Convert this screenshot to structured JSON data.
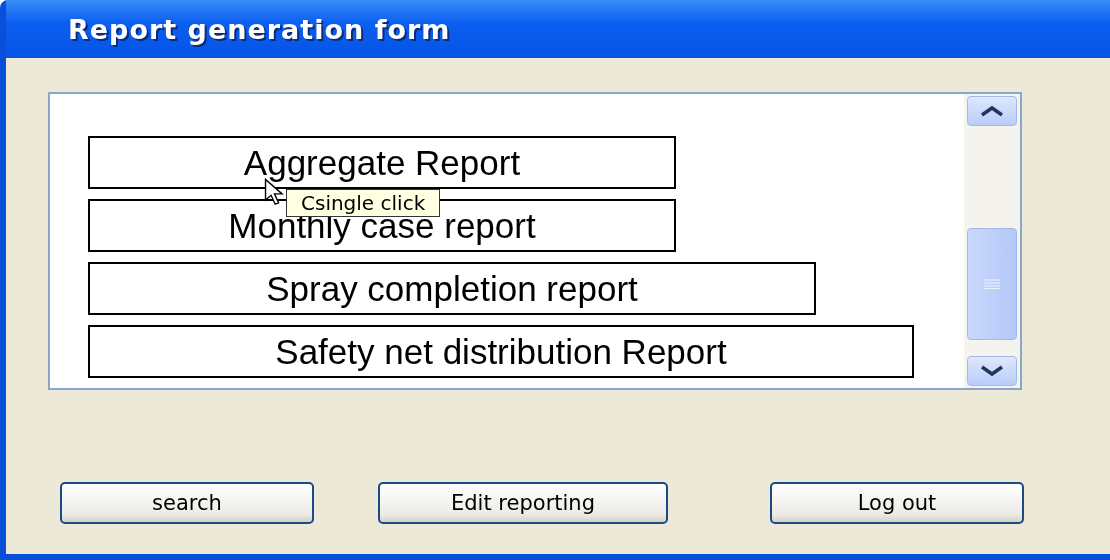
{
  "window": {
    "title": "Report generation form"
  },
  "reports": [
    {
      "label": "Aggregate Report"
    },
    {
      "label": "Monthly case report"
    },
    {
      "label": "Spray completion report"
    },
    {
      "label": "Safety net distribution Report"
    }
  ],
  "tooltip": {
    "text": "Csingle click"
  },
  "buttons": [
    {
      "label": "search"
    },
    {
      "label": "Edit reporting"
    },
    {
      "label": "Log out"
    }
  ]
}
